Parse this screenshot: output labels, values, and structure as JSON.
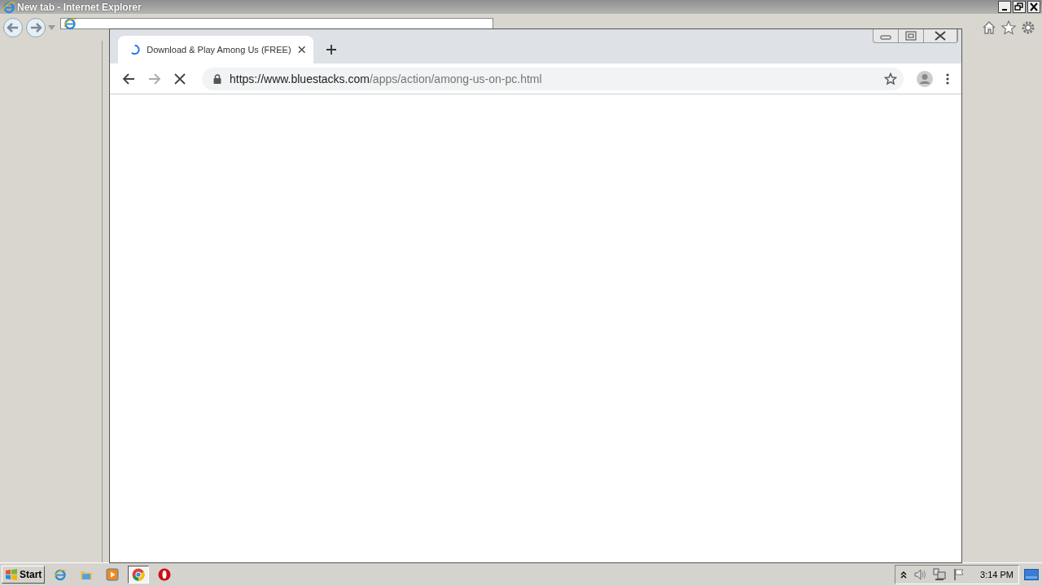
{
  "ie_window": {
    "title": "New tab - Internet Explorer"
  },
  "browser": {
    "tabs": [
      {
        "title": "Download & Play Among Us (FREE)",
        "selected": true,
        "loading": true
      }
    ],
    "address": {
      "host": "https://www.bluestacks.com",
      "path": "/apps/action/among-us-on-pc.html",
      "secure": true
    },
    "loading": true
  },
  "taskbar": {
    "start": "Start",
    "apps": [
      {
        "kind": "ie",
        "selected": false
      },
      {
        "kind": "folder",
        "selected": false
      },
      {
        "kind": "media",
        "selected": false
      },
      {
        "kind": "chrome",
        "selected": true
      },
      {
        "kind": "opera",
        "selected": false
      }
    ],
    "clock": "3:14 PM"
  }
}
